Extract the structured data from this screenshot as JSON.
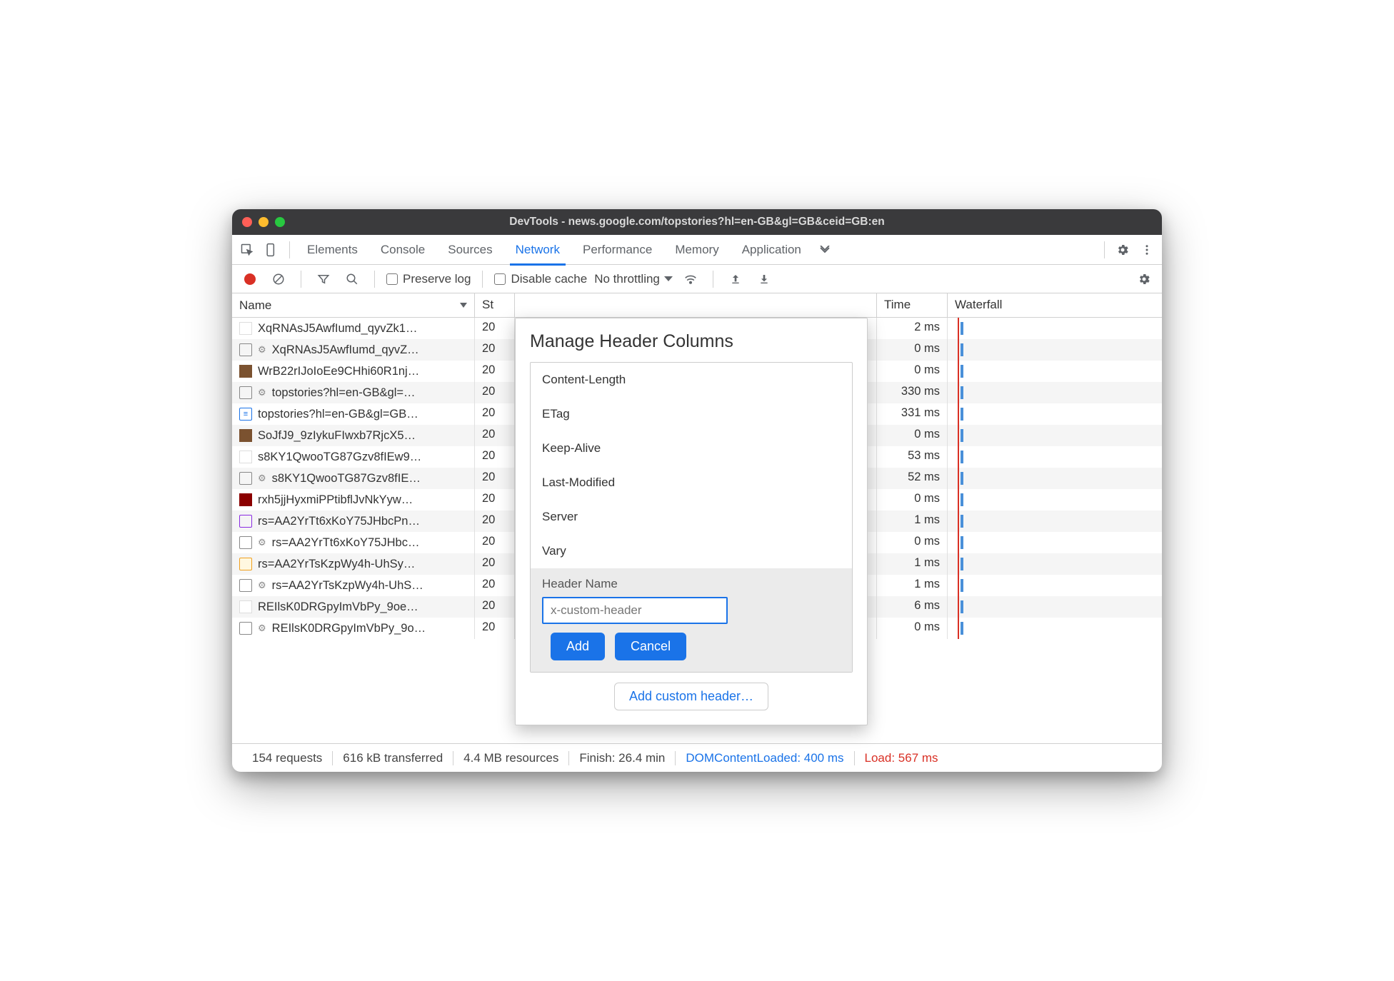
{
  "window": {
    "title": "DevTools - news.google.com/topstories?hl=en-GB&gl=GB&ceid=GB:en"
  },
  "tabs": {
    "items": [
      "Elements",
      "Console",
      "Sources",
      "Network",
      "Performance",
      "Memory",
      "Application"
    ],
    "active": "Network"
  },
  "toolbar": {
    "preserve_log": "Preserve log",
    "disable_cache": "Disable cache",
    "throttling": "No throttling"
  },
  "columns": {
    "name": "Name",
    "status_abbrev": "St",
    "time_abbrev": "Time",
    "waterfall": "Waterfall"
  },
  "requests": [
    {
      "icon": "white",
      "gear": false,
      "name": "XqRNAsJ5AwfIumd_qyvZk1…",
      "status": "20",
      "time": "2 ms"
    },
    {
      "icon": "square",
      "gear": true,
      "name": "XqRNAsJ5AwfIumd_qyvZ…",
      "status": "20",
      "time": "0 ms"
    },
    {
      "icon": "img",
      "gear": false,
      "name": "WrB22rIJoIoEe9CHhi60R1nj…",
      "status": "20",
      "time": "0 ms"
    },
    {
      "icon": "square",
      "gear": true,
      "name": "topstories?hl=en-GB&gl=…",
      "status": "20",
      "time": "330 ms"
    },
    {
      "icon": "doc",
      "gear": false,
      "name": "topstories?hl=en-GB&gl=GB…",
      "status": "20",
      "time": "331 ms"
    },
    {
      "icon": "img",
      "gear": false,
      "name": "SoJfJ9_9zIykuFIwxb7RjcX5…",
      "status": "20",
      "time": "0 ms"
    },
    {
      "icon": "white",
      "gear": false,
      "name": "s8KY1QwooTG87Gzv8fIEw9…",
      "status": "20",
      "time": "53 ms"
    },
    {
      "icon": "square",
      "gear": true,
      "name": "s8KY1QwooTG87Gzv8fIE…",
      "status": "20",
      "time": "52 ms"
    },
    {
      "icon": "img2",
      "gear": false,
      "name": "rxh5jjHyxmiPPtibflJvNkYyw…",
      "status": "20",
      "time": "0 ms"
    },
    {
      "icon": "scr2",
      "gear": false,
      "name": "rs=AA2YrTt6xKoY75JHbcPn…",
      "status": "20",
      "time": "1 ms"
    },
    {
      "icon": "square",
      "gear": true,
      "name": "rs=AA2YrTt6xKoY75JHbc…",
      "status": "20",
      "time": "0 ms"
    },
    {
      "icon": "scr",
      "gear": false,
      "name": "rs=AA2YrTsKzpWy4h-UhSy…",
      "status": "20",
      "time": "1 ms"
    },
    {
      "icon": "square",
      "gear": true,
      "name": "rs=AA2YrTsKzpWy4h-UhS…",
      "status": "20",
      "time": "1 ms"
    },
    {
      "icon": "white",
      "gear": false,
      "name": "REIlsK0DRGpyImVbPy_9oe…",
      "status": "20",
      "time": "6 ms"
    },
    {
      "icon": "square",
      "gear": true,
      "name": "REIlsK0DRGpyImVbPy_9o…",
      "status": "20",
      "time": "0 ms"
    }
  ],
  "status": {
    "requests": "154 requests",
    "transferred": "616 kB transferred",
    "resources": "4.4 MB resources",
    "finish": "Finish: 26.4 min",
    "dcl": "DOMContentLoaded: 400 ms",
    "load": "Load: 567 ms"
  },
  "modal": {
    "title": "Manage Header Columns",
    "headers": [
      "Content-Length",
      "ETag",
      "Keep-Alive",
      "Last-Modified",
      "Server",
      "Vary"
    ],
    "custom_label": "Header Name",
    "placeholder": "x-custom-header",
    "add": "Add",
    "cancel": "Cancel",
    "add_link": "Add custom header…"
  }
}
